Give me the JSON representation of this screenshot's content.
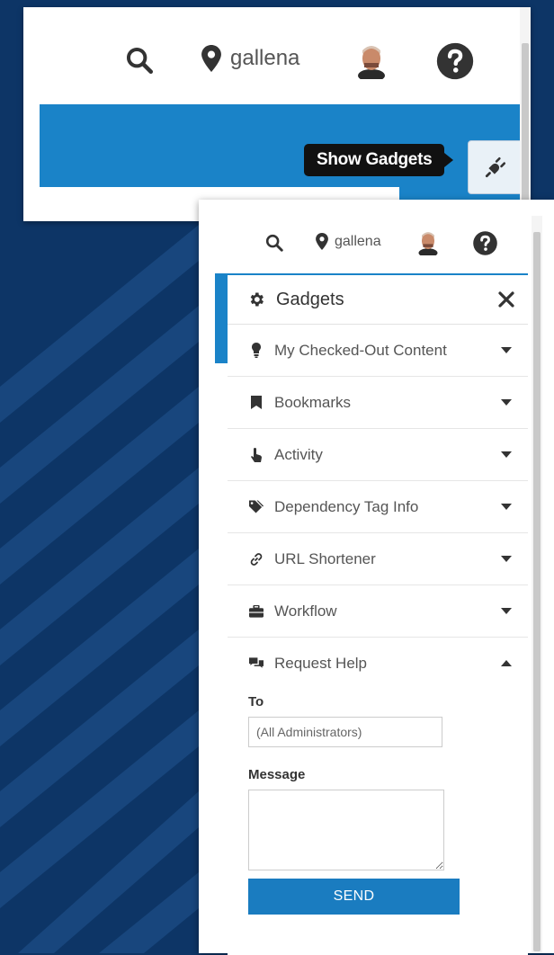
{
  "top_toolbar": {
    "location_label": "gallena",
    "tooltip": "Show Gadgets"
  },
  "bottom_toolbar": {
    "location_label": "gallena"
  },
  "gadgets": {
    "title": "Gadgets",
    "items": [
      {
        "label": "My Checked-Out Content",
        "icon": "lightbulb-icon",
        "state": "collapsed"
      },
      {
        "label": "Bookmarks",
        "icon": "bookmark-icon",
        "state": "collapsed"
      },
      {
        "label": "Activity",
        "icon": "hand-pointer-icon",
        "state": "collapsed"
      },
      {
        "label": "Dependency Tag Info",
        "icon": "tags-icon",
        "state": "collapsed"
      },
      {
        "label": "URL Shortener",
        "icon": "link-icon",
        "state": "collapsed"
      },
      {
        "label": "Workflow",
        "icon": "briefcase-icon",
        "state": "collapsed"
      },
      {
        "label": "Request Help",
        "icon": "comments-icon",
        "state": "expanded"
      }
    ]
  },
  "request_help": {
    "to_label": "To",
    "to_placeholder": "(All Administrators)",
    "message_label": "Message",
    "message_value": "",
    "send_label": "SEND"
  },
  "colors": {
    "background": "#0d3566",
    "accent_blue": "#1a83c8",
    "send_button": "#1a7cc0"
  }
}
